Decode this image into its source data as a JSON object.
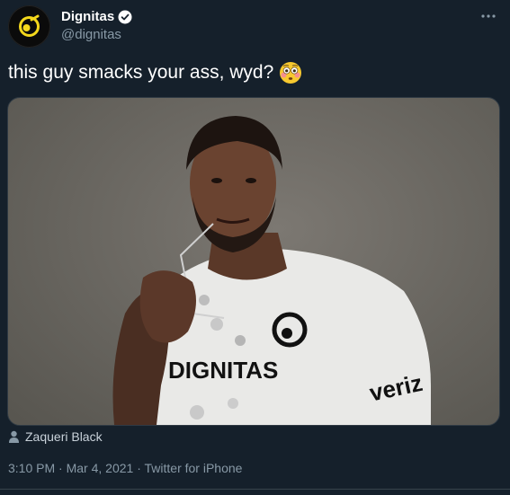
{
  "user": {
    "display_name": "Dignitas",
    "handle": "@dignitas",
    "verified": true,
    "avatar_icon": "dignitas-logo-icon"
  },
  "tweet": {
    "text": "this guy smacks your ass, wyd?",
    "emoji": "flushed-face-emoji",
    "media_tag": "Zaqueri Black",
    "time": "3:10 PM",
    "separator": "·",
    "date": "Mar 4, 2021",
    "source": "Twitter for iPhone"
  },
  "photo": {
    "jersey_text": "DIGNITAS",
    "sponsor_text": "veriz"
  },
  "colors": {
    "background": "#15202b",
    "secondary_text": "#8899a6",
    "verified_badge": "#ffffff",
    "brand_yellow": "#f4d81c"
  }
}
